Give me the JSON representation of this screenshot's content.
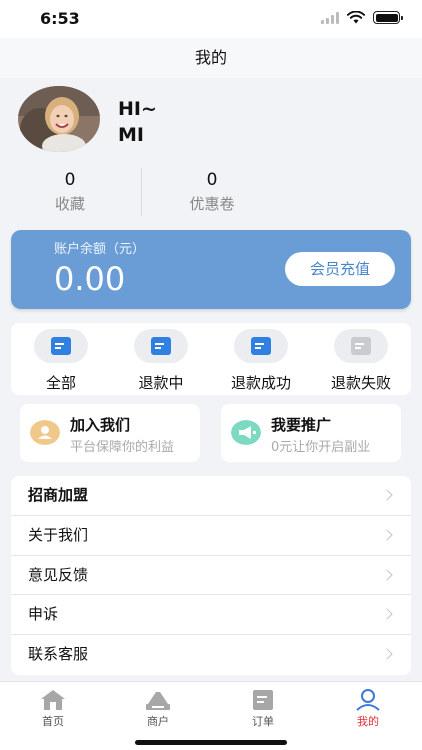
{
  "status_bar": {
    "time": "6:53"
  },
  "nav": {
    "title": "我的"
  },
  "profile": {
    "greeting": "HI~",
    "name": "MI"
  },
  "stats": [
    {
      "value": "0",
      "label": "收藏"
    },
    {
      "value": "0",
      "label": "优惠卷"
    }
  ],
  "balance": {
    "label": "账户余额（元）",
    "value": "0.00",
    "button": "会员充值"
  },
  "orders": [
    {
      "label": "全部"
    },
    {
      "label": "退款中"
    },
    {
      "label": "退款成功"
    },
    {
      "label": "退款失败"
    }
  ],
  "promos": [
    {
      "title": "加入我们",
      "subtitle": "平台保障你的利益"
    },
    {
      "title": "我要推广",
      "subtitle": "0元让你开启副业"
    }
  ],
  "menu": [
    {
      "label": "招商加盟"
    },
    {
      "label": "关于我们"
    },
    {
      "label": "意见反馈"
    },
    {
      "label": "申诉"
    },
    {
      "label": "联系客服"
    }
  ],
  "tabs": [
    {
      "label": "首页"
    },
    {
      "label": "商户"
    },
    {
      "label": "订单"
    },
    {
      "label": "我的"
    }
  ],
  "colors": {
    "accent": "#6a9cd6",
    "active_tab": "#d33333",
    "order_icon": "#2f80e0"
  }
}
